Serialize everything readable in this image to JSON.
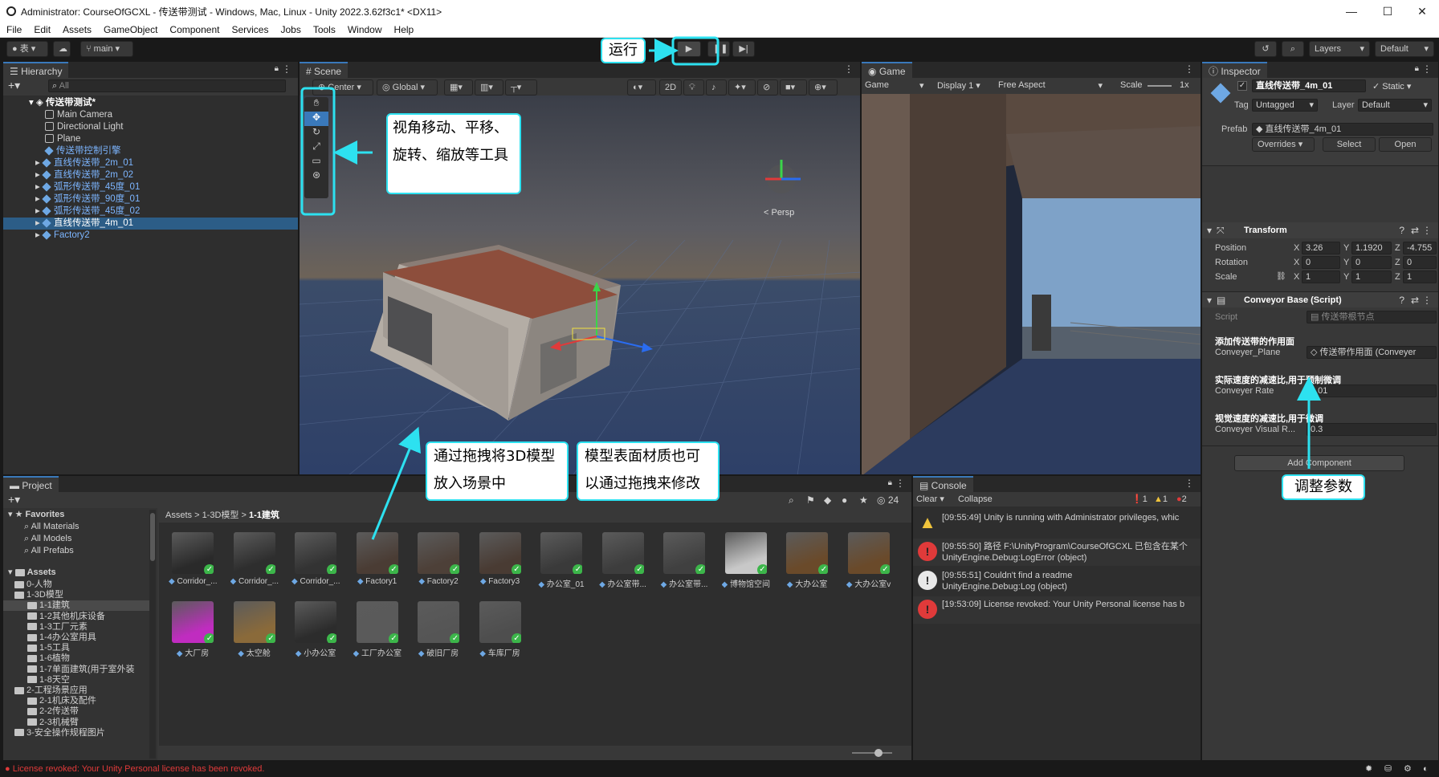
{
  "window": {
    "title": "Administrator: CourseOfGCXL - 传送带测试 - Windows, Mac, Linux - Unity 2022.3.62f3c1* <DX11>"
  },
  "menu": [
    "File",
    "Edit",
    "Assets",
    "GameObject",
    "Component",
    "Services",
    "Jobs",
    "Tools",
    "Window",
    "Help"
  ],
  "toolbar": {
    "account": "表",
    "branch": "main",
    "layers": "Layers",
    "layout": "Default"
  },
  "hierarchy": {
    "tab": "Hierarchy",
    "search_placeholder": "All",
    "scene_name": "传送带测试*",
    "items": [
      {
        "label": "Main Camera",
        "type": "plain"
      },
      {
        "label": "Directional Light",
        "type": "plain"
      },
      {
        "label": "Plane",
        "type": "plain"
      },
      {
        "label": "传送带控制引擎",
        "type": "prefab"
      },
      {
        "label": "直线传送带_2m_01",
        "type": "prefab"
      },
      {
        "label": "直线传送带_2m_02",
        "type": "prefab"
      },
      {
        "label": "弧形传送带_45度_01",
        "type": "prefab"
      },
      {
        "label": "弧形传送带_90度_01",
        "type": "prefab"
      },
      {
        "label": "弧形传送带_45度_02",
        "type": "prefab"
      },
      {
        "label": "直线传送带_4m_01",
        "type": "prefab",
        "selected": true
      },
      {
        "label": "Factory2",
        "type": "prefab"
      }
    ]
  },
  "scene": {
    "tab": "Scene",
    "pivot": "Center",
    "space": "Global",
    "mode_2d": "2D",
    "persp": "< Persp"
  },
  "game": {
    "tab": "Game",
    "mode": "Game",
    "display": "Display 1",
    "aspect": "Free Aspect",
    "scale_label": "Scale",
    "scale_value": "1x"
  },
  "inspector": {
    "tab": "Inspector",
    "object_name": "直线传送带_4m_01",
    "static_label": "Static",
    "tag_label": "Tag",
    "tag_value": "Untagged",
    "layer_label": "Layer",
    "layer_value": "Default",
    "prefab_label": "Prefab",
    "prefab_value": "直线传送带_4m_01",
    "overrides": "Overrides",
    "select": "Select",
    "open": "Open",
    "transform": {
      "title": "Transform",
      "position_label": "Position",
      "rotation_label": "Rotation",
      "scale_label": "Scale",
      "position": {
        "x": "3.26",
        "y": "1.1920",
        "z": "-4.755"
      },
      "rotation": {
        "x": "0",
        "y": "0",
        "z": "0"
      },
      "scale": {
        "x": "1",
        "y": "1",
        "z": "1"
      }
    },
    "conveyor": {
      "title": "Conveyor Base (Script)",
      "script_label": "Script",
      "script_value": "传送带根节点",
      "section1": "添加传送带的作用面",
      "plane_label": "Conveyer_Plane",
      "plane_value": "传送带作用面 (Conveyer",
      "section2": "实际速度的减速比,用于预制微调",
      "rate_label": "Conveyer Rate",
      "rate_value": "0.01",
      "section3": "视觉速度的减速比,用于微调",
      "visual_label": "Conveyer Visual R...",
      "visual_value": "0.3"
    },
    "add_component": "Add Component"
  },
  "project": {
    "tab": "Project",
    "favorites_title": "Favorites",
    "favorites": [
      "All Materials",
      "All Models",
      "All Prefabs"
    ],
    "assets_title": "Assets",
    "tree": [
      {
        "label": "0-人物",
        "depth": 1
      },
      {
        "label": "1-3D模型",
        "depth": 1
      },
      {
        "label": "1-1建筑",
        "depth": 2,
        "selected": true
      },
      {
        "label": "1-2其他机床设备",
        "depth": 2
      },
      {
        "label": "1-3工厂元素",
        "depth": 2
      },
      {
        "label": "1-4办公室用具",
        "depth": 2
      },
      {
        "label": "1-5工具",
        "depth": 2
      },
      {
        "label": "1-6植物",
        "depth": 2
      },
      {
        "label": "1-7单面建筑(用于室外装",
        "depth": 2
      },
      {
        "label": "1-8天空",
        "depth": 2
      },
      {
        "label": "2-工程场景应用",
        "depth": 1
      },
      {
        "label": "2-1机床及配件",
        "depth": 2
      },
      {
        "label": "2-2传送带",
        "depth": 2
      },
      {
        "label": "2-3机械臂",
        "depth": 2
      },
      {
        "label": "3-安全操作规程图片",
        "depth": 1
      }
    ],
    "breadcrumb": [
      "Assets",
      "1-3D模型",
      "1-1建筑"
    ],
    "hidden_count": "24",
    "assets": [
      {
        "label": "Corridor_...",
        "color": "#2a2a2a"
      },
      {
        "label": "Corridor_...",
        "color": "#2e2e2e"
      },
      {
        "label": "Corridor_...",
        "color": "#333333"
      },
      {
        "label": "Factory1",
        "color": "#4a3c34"
      },
      {
        "label": "Factory2",
        "color": "#4d4038"
      },
      {
        "label": "Factory3",
        "color": "#493b33"
      },
      {
        "label": "办公室_01",
        "color": "#3a3a3a"
      },
      {
        "label": "办公室带...",
        "color": "#3d3d3d"
      },
      {
        "label": "办公室带...",
        "color": "#404040"
      },
      {
        "label": "博物馆空间",
        "color": "#c8c8c8"
      },
      {
        "label": "大办公室",
        "color": "#6a4a2a"
      },
      {
        "label": "大办公室v",
        "color": "#6a4a2a"
      },
      {
        "label": "大厂房",
        "color": "#c02cc0"
      },
      {
        "label": "太空舱",
        "color": "#8a6a3a"
      },
      {
        "label": "小办公室",
        "color": "#2c2c2c"
      },
      {
        "label": "工厂办公室",
        "color": "#5a5a5a"
      },
      {
        "label": "破旧厂房",
        "color": "#555555"
      },
      {
        "label": "车库厂房",
        "color": "#4e4e4e"
      }
    ]
  },
  "console": {
    "tab": "Console",
    "clear": "Clear",
    "collapse": "Collapse",
    "count_info": "1",
    "count_warn": "1",
    "count_error": "2",
    "entries": [
      {
        "type": "warn",
        "line1": "[09:55:49] Unity is running with Administrator privileges, whic",
        "line2": ""
      },
      {
        "type": "error",
        "line1": "[09:55:50] 路径 F:\\UnityProgram\\CourseOfGCXL 已包含在某个",
        "line2": "UnityEngine.Debug:LogError (object)"
      },
      {
        "type": "info",
        "line1": "[09:55:51] Couldn't find a readme",
        "line2": "UnityEngine.Debug:Log (object)"
      },
      {
        "type": "error",
        "line1": "[19:53:09] License revoked: Your Unity Personal license has b",
        "line2": ""
      }
    ]
  },
  "statusbar": {
    "message": "License revoked: Your Unity Personal license has been revoked."
  },
  "callouts": {
    "run": "运行",
    "tools": "视角移动、平移、旋转、缩放等工具",
    "drag_model": "通过拖拽将3D模型放入场景中",
    "material": "模型表面材质也可以通过拖拽来修改",
    "params": "调整参数"
  },
  "colors": {
    "accent": "#2de1f0",
    "selection": "#2c5d87",
    "error": "#e03a3a",
    "warn": "#f0c43c"
  }
}
